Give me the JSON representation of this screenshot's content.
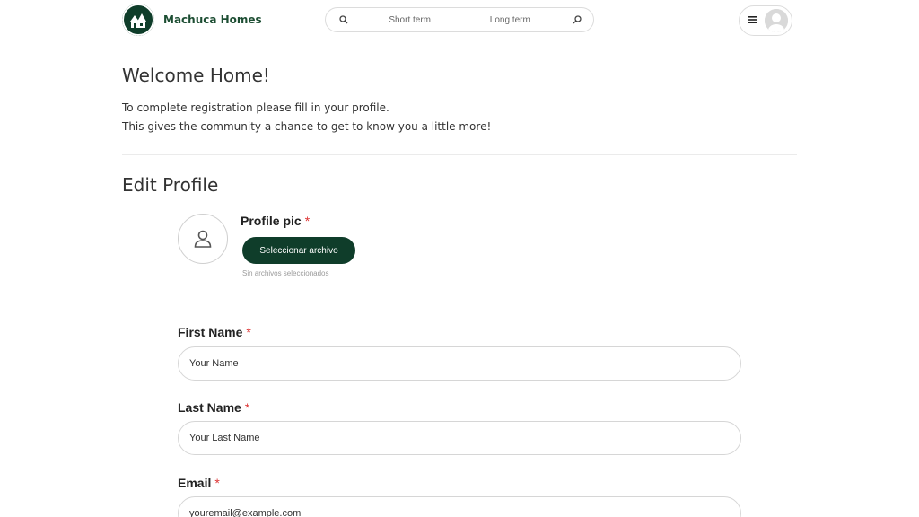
{
  "header": {
    "brand": "Machuca Homes",
    "search": {
      "short_term": "Short term",
      "long_term": "Long term"
    }
  },
  "main": {
    "welcome_title": "Welcome Home!",
    "intro_line_1": "To complete registration please fill in your profile.",
    "intro_line_2": "This gives the community a chance to get to know you a little more!",
    "edit_title": "Edit Profile",
    "profile_pic": {
      "label": "Profile pic",
      "required_mark": "*",
      "button_label": "Seleccionar archivo",
      "file_status": "Sin archivos seleccionados"
    },
    "fields": {
      "first_name": {
        "label": "First Name",
        "required_mark": "*",
        "value": "Your Name"
      },
      "last_name": {
        "label": "Last Name",
        "required_mark": "*",
        "value": "Your Last Name"
      },
      "email": {
        "label": "Email",
        "required_mark": "*",
        "value": "youremail@example.com"
      }
    }
  },
  "colors": {
    "brand": "#0f3d2a",
    "required": "#dd3333",
    "border": "#d6d6d6"
  },
  "icons": {
    "logo": "machuca-homes-logo",
    "search_left": "search-icon",
    "search_right": "search-icon",
    "menu": "hamburger-menu-icon",
    "avatar": "user-avatar-icon",
    "profile_placeholder": "user-icon"
  }
}
